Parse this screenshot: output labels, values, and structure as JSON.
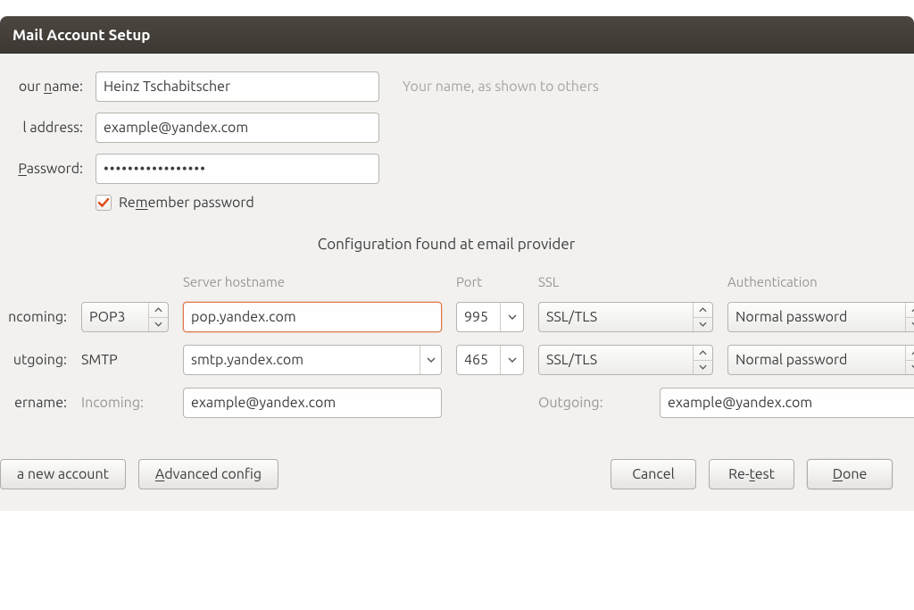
{
  "window": {
    "title": "Mail Account Setup"
  },
  "identity": {
    "name_label": "our name:",
    "name_value": "Heinz Tschabitscher",
    "name_hint": "Your name, as shown to others",
    "email_label": "l address:",
    "email_value": "example@yandex.com",
    "password_label": "Password:",
    "password_value": "•••••••••••••••••",
    "remember_label": "Remember password"
  },
  "status": "Configuration found at email provider",
  "columns": {
    "server": "Server hostname",
    "port": "Port",
    "ssl": "SSL",
    "auth": "Authentication"
  },
  "incoming": {
    "label": "ncoming:",
    "protocol": "POP3",
    "hostname": "pop.yandex.com",
    "port": "995",
    "ssl": "SSL/TLS",
    "auth": "Normal password"
  },
  "outgoing": {
    "label": "utgoing:",
    "protocol": "SMTP",
    "hostname": "smtp.yandex.com",
    "port": "465",
    "ssl": "SSL/TLS",
    "auth": "Normal password"
  },
  "username": {
    "label": "ername:",
    "incoming_label": "Incoming:",
    "incoming_value": "example@yandex.com",
    "outgoing_label": "Outgoing:",
    "outgoing_value": "example@yandex.com"
  },
  "buttons": {
    "new_account": "a new account",
    "advanced": "Advanced config",
    "cancel": "Cancel",
    "retest": "Re-test",
    "done_prefix": "D",
    "done_rest": "one"
  }
}
